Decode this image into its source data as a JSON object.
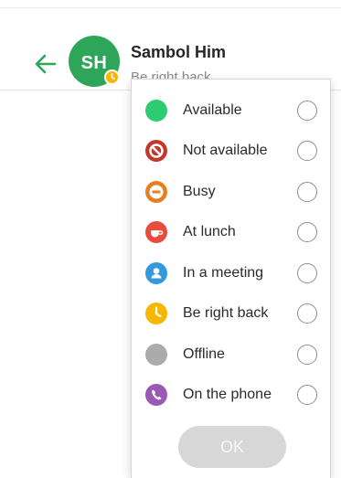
{
  "contact": {
    "initials": "SH",
    "name": "Sambol Him",
    "status": "Be right back"
  },
  "status_options": [
    {
      "label": "Available",
      "icon": "available-icon",
      "color": "#2ecc71",
      "selected": false
    },
    {
      "label": "Not available",
      "icon": "not-available-icon",
      "color": "#c0392b",
      "selected": false
    },
    {
      "label": "Busy",
      "icon": "busy-icon",
      "color": "#e67e22",
      "selected": false
    },
    {
      "label": "At lunch",
      "icon": "lunch-icon",
      "color": "#e74c3c",
      "selected": false
    },
    {
      "label": "In a meeting",
      "icon": "meeting-icon",
      "color": "#3498db",
      "selected": false
    },
    {
      "label": "Be right back",
      "icon": "clock-icon",
      "color": "#f5b700",
      "selected": false
    },
    {
      "label": "Offline",
      "icon": "offline-icon",
      "color": "#ababab",
      "selected": false
    },
    {
      "label": "On the phone",
      "icon": "phone-icon",
      "color": "#9b59b6",
      "selected": false
    }
  ],
  "ok_label": "OK",
  "colors": {
    "accent": "#2ea65a",
    "avatar": "#2ea65a",
    "badge": "#f5b700",
    "ok_disabled": "#d7d7d7"
  }
}
